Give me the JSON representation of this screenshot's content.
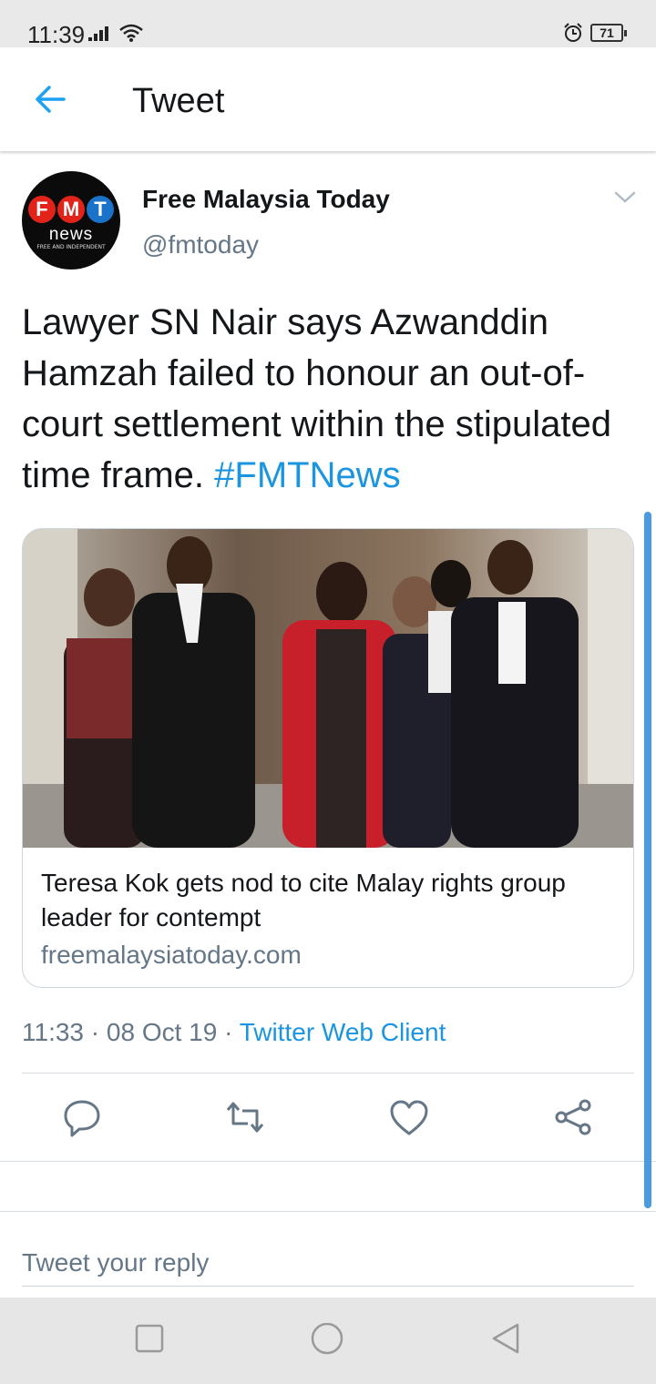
{
  "status_bar": {
    "time": "11:39",
    "battery": "71",
    "icons": [
      "signal-icon",
      "wifi-icon",
      "alarm-icon",
      "battery-icon"
    ]
  },
  "header": {
    "title": "Tweet",
    "back_icon": "arrow-left-icon"
  },
  "tweet": {
    "author": {
      "name": "Free Malaysia Today",
      "handle": "@fmtoday",
      "avatar": {
        "letters": [
          "F",
          "M",
          "T"
        ],
        "letter_colors": [
          "#e2231a",
          "#e2231a",
          "#1a73c9"
        ],
        "word": "news",
        "tagline": "FREE AND INDEPENDENT"
      }
    },
    "text": "Lawyer SN Nair says Azwanddin Hamzah failed to honour an out-of-court settlement within the stipulated time frame.",
    "hashtag": "#FMTNews",
    "card": {
      "title": "Teresa Kok gets nod to cite Malay rights group leader for contempt",
      "domain": "freemalaysiatoday.com"
    },
    "meta": {
      "time": "11:33",
      "separator": " · ",
      "date": "08 Oct 19",
      "client": "Twitter Web Client"
    },
    "actions": [
      "reply-icon",
      "retweet-icon",
      "like-icon",
      "share-icon"
    ]
  },
  "reply": {
    "placeholder": "Tweet your reply"
  },
  "nav": [
    "recents-icon",
    "home-icon",
    "back-icon"
  ],
  "colors": {
    "accent": "#1b95e0",
    "secondary_text": "#657786",
    "primary_text": "#14171a"
  }
}
